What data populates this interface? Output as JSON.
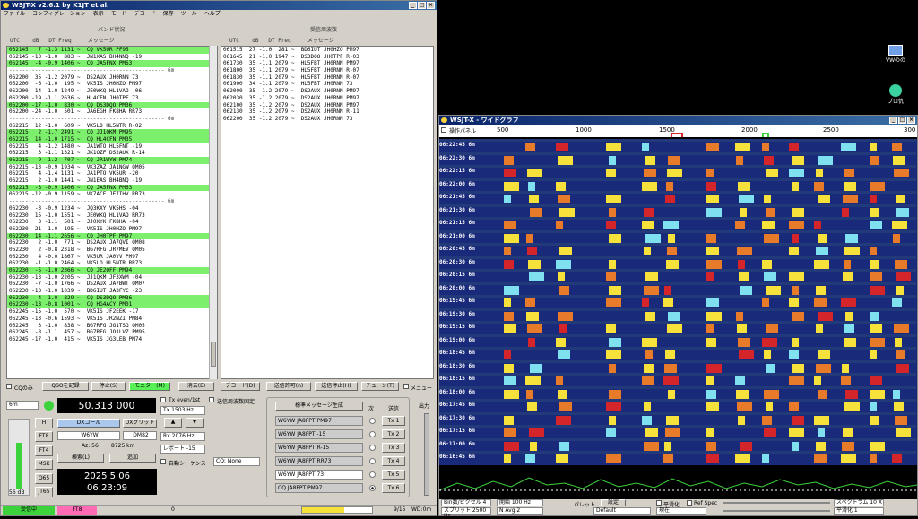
{
  "main_window": {
    "title": "WSJT-X   v2.6.1   by K1JT et al.",
    "menu": [
      "ファイル",
      "コンフィグレーション",
      "表示",
      "モード",
      "デコード",
      "保存",
      "ツール",
      "ヘルプ"
    ],
    "band_panel_title": "バンド状況",
    "rx_panel_title": "受信周波数",
    "col_headers": "UTC    dB   DT Freq     メッセージ",
    "band_rows": [
      {
        "t": "062145   7 -1.3 1131 ~  CQ VK5UR PF95",
        "g": true
      },
      {
        "t": "062145 -13 -1.0  883 ~  JN1XAS BH4NNQ -19",
        "g": false
      },
      {
        "t": "062145  -4 -0.9 1406 ~  CQ JA5FNX PM63",
        "g": true
      },
      {
        "t": "------------------------------------------------ 6m",
        "s": true
      },
      {
        "t": "062200  35 -1.2 2079 ~  DS2AUX JH0RNN 73",
        "g": false
      },
      {
        "t": "062200  -6 -1.0  195 ~  VK5IS JH0HZO PM97",
        "g": false
      },
      {
        "t": "062200 -14 -1.0 1249 ~  JE0WKQ HL1VAO -06",
        "g": false
      },
      {
        "t": "062200 -19 -1.1 2636 ~  HL4CFN JH0TPF 73",
        "g": false
      },
      {
        "t": "062200 -17 -1.0  830 ~  CQ DS3DQO PM36",
        "g": true
      },
      {
        "t": "062200 -24 -1.0  501 ~  JA6EGH FK8HA RR73",
        "g": false
      },
      {
        "t": "------------------------------------------------ 6m",
        "s": true
      },
      {
        "t": "062215  12 -1.0  609 ~  VK5LO HL5NTR R-02",
        "g": false
      },
      {
        "t": "062215   2 -1.7 2491 ~  CQ JJ1QKM PM95",
        "g": true
      },
      {
        "t": "062215  14 -1.0 1715 ~  CQ HL4CFN PM35",
        "g": true
      },
      {
        "t": "062215   4 -1.2 1480 ~  JA1WTO HL5FNT -19",
        "g": false
      },
      {
        "t": "062215   3 -1.1 1321 ~  JK1OZF DS2AUX R-14",
        "g": false
      },
      {
        "t": "062215  -9 -1.2  707 ~  CQ JR1WYW PM74",
        "g": true
      },
      {
        "t": "062215 -13 -0.9 1934 ~  VK3ZAZ JA1NGW QM05",
        "g": false
      },
      {
        "t": "062215   4 -1.4 1131 ~  JA1PTO VK5UR -20",
        "g": false
      },
      {
        "t": "062215   2 -1.0 1441 ~  JN1EAS BH4BNQ -19",
        "g": false
      },
      {
        "t": "062215  -3 -0.9 1406 ~  CQ JA5FNX PM63",
        "g": true
      },
      {
        "t": "062215 -12 -0.9 1159 ~  VK7ACE JE7IHV RR73",
        "g": false
      },
      {
        "t": "------------------------------------------------ 6m",
        "s": true
      },
      {
        "t": "062230  -3 -0.9 1234 ~  JQ3KXY VK5HS -04",
        "g": false
      },
      {
        "t": "062230  15 -1.0 1551 ~  JE0WKQ HL1VAO RR73",
        "g": false
      },
      {
        "t": "062230   3 -1.1  501 ~  JJ0XYK FK8HA -04",
        "g": false
      },
      {
        "t": "062230  21 -1.0  195 ~  VK5IS JH0HZO PM97",
        "g": false
      },
      {
        "t": "062230  14 -1.1 2656 ~  CQ JH0TPF PM97",
        "g": true
      },
      {
        "t": "062230   2 -1.0  771 ~  DS2AUX JA7QVI QM08",
        "g": false
      },
      {
        "t": "062230   2 -0.8 2318 ~  BG7RFG JR7MEV QM05",
        "g": false
      },
      {
        "t": "062230   4 -0.0 1867 ~  VK5UR JA0VV PM97",
        "g": false
      },
      {
        "t": "062230  -1 -1.0 2464 ~  VK5LO HL5NTR RR73",
        "g": false
      },
      {
        "t": "062230  -5 -1.0 2366 ~  CQ JE2OFF PM94",
        "g": true
      },
      {
        "t": "062230 -13 -1.0 2205 ~  JJ1QKM JF3XWM -04",
        "g": false
      },
      {
        "t": "062230  -7 -1.0 1766 ~  DS2AUX JA7BWT QM07",
        "g": false
      },
      {
        "t": "062230 -13 -1.0 1039 ~  BD6IUT JA3FYC -23",
        "g": false
      },
      {
        "t": "062230   4 -1.0  829 ~  CQ DS3DQO PM36",
        "g": true
      },
      {
        "t": "062230 -13 -0.8 1001 ~  CQ HG4ACY PM01",
        "g": true
      },
      {
        "t": "062245 -15 -1.0  570 ~  VK5IS JF2EEK -17",
        "g": false
      },
      {
        "t": "062245 -13 -0.6 1593 ~  VK5IS JR2NZI PM84",
        "g": false
      },
      {
        "t": "062245   3 -1.0  838 ~  BG7RFG JG1TSG QM05",
        "g": false
      },
      {
        "t": "062245  -8 -1.1  457 ~  BG7RFG JO1LVZ PM95",
        "g": false
      },
      {
        "t": "062245 -17 -1.0  415 ~  VK5IS JG3LEB PM74",
        "g": false
      }
    ],
    "rx_rows": [
      "061515  27 -1.0  281 ~  BD6IUT JH0HZO PM97",
      "061645  21 -1.0 1947 ~  DS3DQO JH0TPF R-03",
      "061730  35 -1.1 2079 ~  HL5FBT JH0RNN PM97",
      "061800  35 -1.1 2079 ~  HL5FBT JH0RNN R-07",
      "061830  35 -1.1 2079 ~  HL5FBT JH0RNN R-07",
      "061900  34 -1.1 2079 ~  HL5FBT JH0RNN 73",
      "062000  35 -1.2 2079 ~  DS2AUX JH0RNN PM97",
      "062030  35 -1.2 2079 ~  DS2AUX JH0RNN PM97",
      "062100  35 -1.2 2079 ~  DS2AUX JH0RNN PM97",
      "062130  35 -1.2 2079 ~  DS2AUX JH0RNN R-11",
      "062200  35 -1.2 2079 ~  DS2AUX JH0RNN 73"
    ],
    "buttons": {
      "cq_only": "CQのみ",
      "log_qso": "QSOを記録",
      "stop": "停止(S)",
      "monitor": "モニター(M)",
      "erase": "消去(E)",
      "decode": "デコード(D)",
      "enable_tx": "送信許可(n)",
      "halt_tx": "送信停止(H)",
      "tune": "チューン(T)",
      "menu": "メニュー"
    },
    "band_select": "6m",
    "frequency": "50.313 000",
    "tx_even": "Tx even/1st",
    "hold_tx": "送信周波数固定",
    "tx_freq": "Tx  1503 Hz",
    "rx_freq": "Rx  2076 Hz",
    "report": "レポート -15",
    "auto_seq": "自動シーケンス",
    "cq_none": "CQ: None",
    "dx_call_label": "DXコール",
    "dx_grid_label": "DXグリッド",
    "dx_call": "W6YW",
    "dx_grid": "DM82",
    "az": "Az: 56",
    "dist": "8725 km",
    "lookup": "検索(L)",
    "add": "追加",
    "date": "2025 5 06",
    "time": "06:23:09",
    "side": [
      "H",
      "FT8",
      "FT4",
      "MSK",
      "Q65",
      "JT65"
    ],
    "db_label": "56 dB",
    "std_msg": "標準メッセージ生成",
    "next": "次",
    "now": "送信",
    "tx_msgs": [
      "W6YW JA8FPT PM97",
      "W6YW JA8FPT -15",
      "W6YW JA8FPT R-15",
      "W6YW JA8FPT RR73",
      "W6YW JA8FPT 73",
      "CQ JA8FPT PM97"
    ],
    "tx_btns": [
      "Tx 1",
      "Tx 2",
      "Tx 3",
      "Tx 4",
      "Tx 5",
      "Tx 6"
    ],
    "pwr": "出力",
    "status": {
      "rx": "受信中",
      "mode": "FT8",
      "val": "0",
      "seq": "9/15",
      "wd": "WD:0m"
    }
  },
  "waterfall": {
    "title": "WSJT-X - ワイドグラフ",
    "panel": "操作パネル",
    "scale": [
      "500",
      "1000",
      "1500",
      "2000",
      "2500",
      "300"
    ],
    "timestamps": [
      "06:22:45",
      "06:22:30",
      "06:22:15",
      "06:22:00",
      "06:21:45",
      "06:21:30",
      "06:21:15",
      "06:21:00",
      "06:20:45",
      "06:20:30",
      "06:20:15",
      "06:20:00",
      "06:19:45",
      "06:19:30",
      "06:19:15",
      "06:19:00",
      "06:18:45",
      "06:18:30",
      "06:18:15",
      "06:18:00",
      "06:17:45",
      "06:17:30",
      "06:17:15",
      "06:17:00",
      "06:16:45"
    ],
    "band": "6m",
    "controls": {
      "bins": "Bin数/ピクセル 4",
      "start": "開始 100 Hz",
      "split": "スプリット 2500 Hz",
      "navg": "N Avg 2",
      "palette": "パレット",
      "adjust": "設定",
      "default": "Default",
      "flatten": "平滑化",
      "ref": "Ref Spec",
      "current": "現在",
      "spectrum": "スペクトラム 10 X",
      "smooth": "平滑化 1"
    }
  },
  "desktop": {
    "icon1": "VWのの",
    "icon2": "ブロ仇"
  }
}
